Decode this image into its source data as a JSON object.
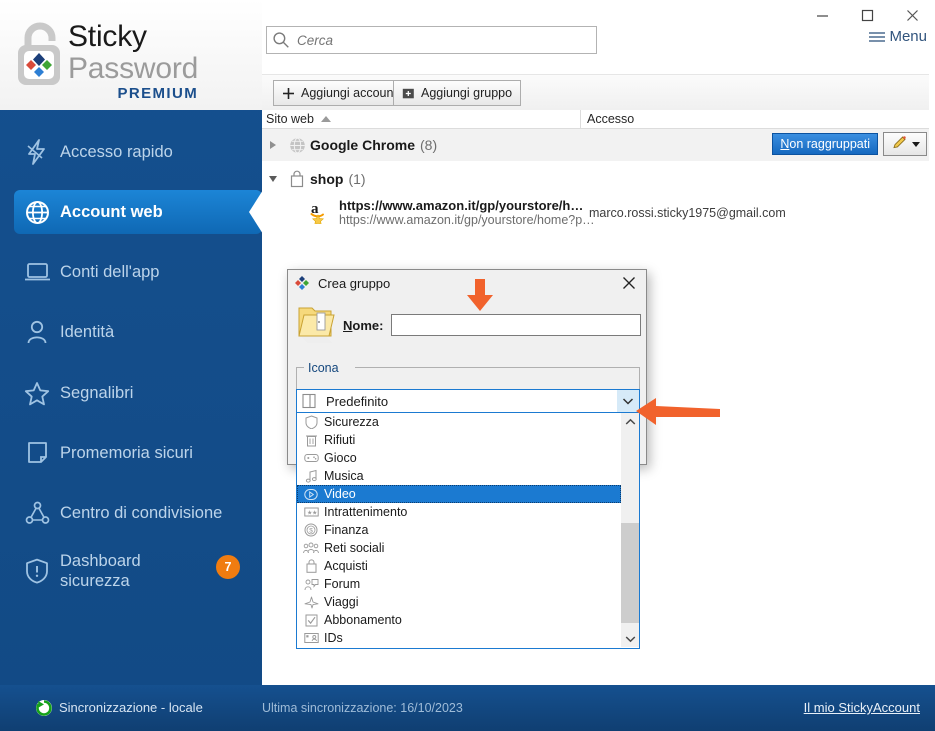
{
  "brand": {
    "line1": "Sticky",
    "line2": "Password",
    "edition": "PREMIUM",
    "accent": "#1c4f8c",
    "sidebar_bg": "#144e8c"
  },
  "window": {
    "minimize": "–",
    "maximize": "☐",
    "close": "✕"
  },
  "search": {
    "placeholder": "Cerca",
    "value": "",
    "icon": "search-icon"
  },
  "menu": {
    "label": "Menu",
    "icon": "hamburger-icon"
  },
  "sidebar": {
    "items": [
      {
        "label": "Accesso rapido",
        "icon": "lightning-icon",
        "active": false,
        "badge": ""
      },
      {
        "label": "Account web",
        "icon": "globe-icon",
        "active": true,
        "badge": ""
      },
      {
        "label": "Conti dell'app",
        "icon": "laptop-icon",
        "active": false,
        "badge": ""
      },
      {
        "label": "Identità",
        "icon": "person-icon",
        "active": false,
        "badge": ""
      },
      {
        "label": "Segnalibri",
        "icon": "star-icon",
        "active": false,
        "badge": ""
      },
      {
        "label": "Promemoria sicuri",
        "icon": "note-icon",
        "active": false,
        "badge": ""
      },
      {
        "label": "Centro di condivisione",
        "icon": "share-icon",
        "active": false,
        "badge": ""
      },
      {
        "label": "Dashboard sicurezza",
        "icon": "shield-alert-icon",
        "active": false,
        "badge": "7"
      }
    ]
  },
  "toolbar": {
    "add_account": "Aggiungi account",
    "add_group": "Aggiungi gruppo"
  },
  "columns": {
    "site": "Sito web",
    "access": "Accesso",
    "sort": "ascending"
  },
  "list": {
    "groups": [
      {
        "name": "Google Chrome",
        "count": "(8)",
        "icon": "globe-gray-icon",
        "expanded": false
      },
      {
        "name": "shop",
        "count": "(1)",
        "icon": "bag-icon",
        "expanded": true
      }
    ],
    "entry": {
      "title": "https://www.amazon.it/gp/yourstore/h…",
      "subtitle": "https://www.amazon.it/gp/yourstore/home?p…",
      "login": "marco.rossi.sticky1975@gmail.com",
      "icon": "amazon-favicon"
    },
    "ungrouped_badge": {
      "underlined": "N",
      "rest": "on raggruppati"
    },
    "edit_button": {
      "icon": "pencil-icon",
      "caret": "chevron-down-icon"
    }
  },
  "dialog": {
    "title": "Crea gruppo",
    "icon": "sticky-password-icon",
    "close": "✕",
    "folder_icon": "open-folder-icon",
    "name_label_underlined": "N",
    "name_label_rest": "ome:",
    "name_value": "",
    "group_legend": "Icona",
    "combo": {
      "selected_label": "Predefinito",
      "selected_icon": "default-folder-icon",
      "arrow": "chevron-down-icon",
      "options": [
        {
          "label": "Sicurezza",
          "icon": "shield-icon",
          "selected": false
        },
        {
          "label": "Rifiuti",
          "icon": "trash-icon",
          "selected": false
        },
        {
          "label": "Gioco",
          "icon": "gamepad-icon",
          "selected": false
        },
        {
          "label": "Musica",
          "icon": "music-note-icon",
          "selected": false
        },
        {
          "label": "Video",
          "icon": "play-circle-icon",
          "selected": true
        },
        {
          "label": "Intrattenimento",
          "icon": "ticket-icon",
          "selected": false
        },
        {
          "label": "Finanza",
          "icon": "coin-icon",
          "selected": false
        },
        {
          "label": "Reti sociali",
          "icon": "people-icon",
          "selected": false
        },
        {
          "label": "Acquisti",
          "icon": "bag-icon",
          "selected": false
        },
        {
          "label": "Forum",
          "icon": "person-chat-icon",
          "selected": false
        },
        {
          "label": "Viaggi",
          "icon": "airplane-icon",
          "selected": false
        },
        {
          "label": "Abbonamento",
          "icon": "checkbox-icon",
          "selected": false
        },
        {
          "label": "IDs",
          "icon": "id-card-icon",
          "selected": false
        }
      ],
      "scroll_up": "chevron-up-icon",
      "scroll_down": "chevron-down-icon"
    }
  },
  "footer": {
    "sync_label": "Sincronizzazione - locale",
    "sync_icon": "sync-icon",
    "last_sync": "Ultima sincronizzazione: 16/10/2023",
    "account_link": "Il mio StickyAccount"
  },
  "annotations": {
    "arrow_down_color": "#f1622c",
    "arrow_left_color": "#f1622c"
  }
}
